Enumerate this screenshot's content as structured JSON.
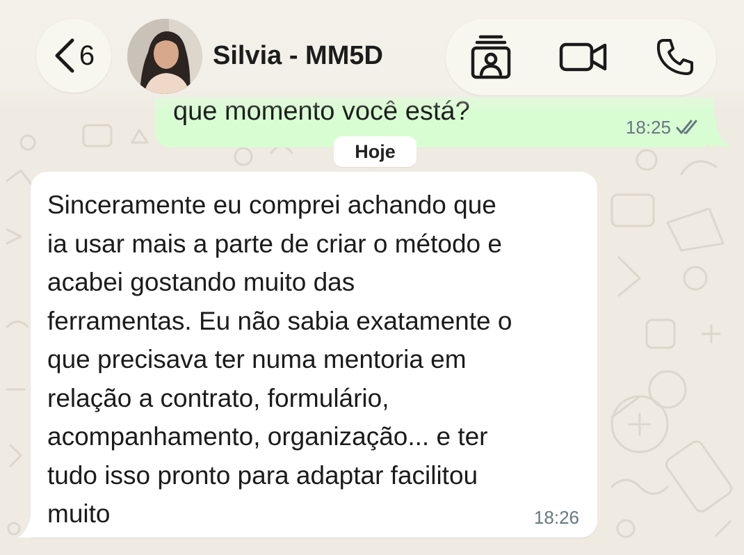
{
  "header": {
    "back_count": "6",
    "contact_name": "Silvia - MM5D",
    "icons": {
      "back": "chevron-left-icon",
      "contact_card": "contact-card-icon",
      "video": "video-camera-icon",
      "phone": "phone-icon"
    }
  },
  "messages": [
    {
      "direction": "outgoing",
      "text": "que momento você está?",
      "time": "18:25",
      "status": "read"
    },
    {
      "direction": "incoming",
      "text": "Sinceramente eu comprei achando que\nia usar mais a parte de criar o método e\nacabei gostando muito das\nferramentas. Eu não sabia exatamente o\nque precisava ter numa mentoria em\nrelação a contrato, formulário,\nacompanhamento, organização... e ter\ntudo isso pronto para adaptar facilitou\nmuito",
      "time": "18:26"
    }
  ],
  "day_separator": "Hoje",
  "colors": {
    "wallpaper": "#efeae2",
    "outgoing_bubble": "#d9fdd3",
    "incoming_bubble": "#ffffff",
    "timestamp": "#667781",
    "read_ticks": "#667781"
  }
}
